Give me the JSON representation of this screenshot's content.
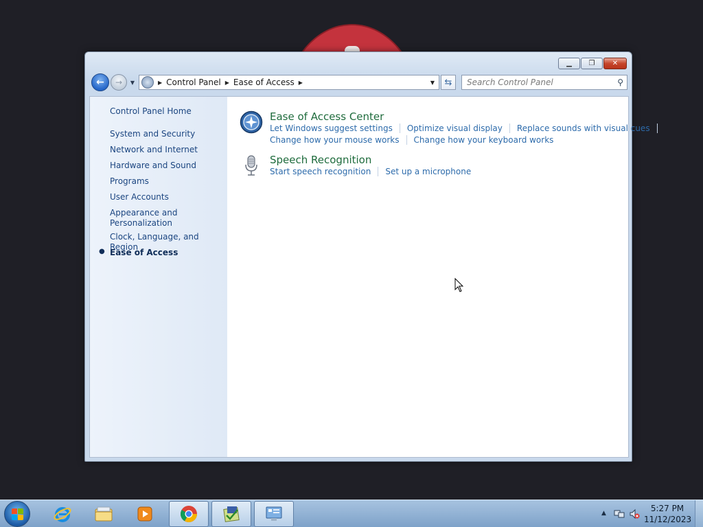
{
  "window": {
    "caption_buttons": {
      "minimize_icon": "minimize-icon",
      "maximize_icon": "maximize-icon",
      "close_icon": "close-icon"
    },
    "address_bar": {
      "breadcrumbs": [
        "Control Panel",
        "Ease of Access"
      ]
    },
    "search": {
      "placeholder": "Search Control Panel"
    }
  },
  "sidebar": {
    "home": "Control Panel Home",
    "items": [
      {
        "label": "System and Security"
      },
      {
        "label": "Network and Internet"
      },
      {
        "label": "Hardware and Sound"
      },
      {
        "label": "Programs"
      },
      {
        "label": "User Accounts"
      },
      {
        "label": "Appearance and Personalization"
      },
      {
        "label": "Clock, Language, and Region"
      },
      {
        "label": "Ease of Access",
        "current": true
      }
    ]
  },
  "main": {
    "categories": [
      {
        "title": "Ease of Access Center",
        "icon": "ease-of-access-icon",
        "tasks": [
          [
            "Let Windows suggest settings",
            "Optimize visual display",
            "Replace sounds with visual cues"
          ],
          [
            "Change how your mouse works",
            "Change how your keyboard works"
          ]
        ]
      },
      {
        "title": "Speech Recognition",
        "icon": "microphone-icon",
        "tasks": [
          [
            "Start speech recognition",
            "Set up a microphone"
          ]
        ]
      }
    ]
  },
  "taskbar": {
    "pinned": [
      {
        "name": "internet-explorer-icon",
        "active": false
      },
      {
        "name": "file-explorer-icon",
        "active": false
      },
      {
        "name": "media-player-icon",
        "active": false
      },
      {
        "name": "chrome-icon",
        "active": true
      },
      {
        "name": "notepad-app-icon",
        "active": true
      },
      {
        "name": "control-panel-icon",
        "active": true
      }
    ],
    "clock": {
      "time": "5:27 PM",
      "date": "11/12/2023"
    }
  }
}
